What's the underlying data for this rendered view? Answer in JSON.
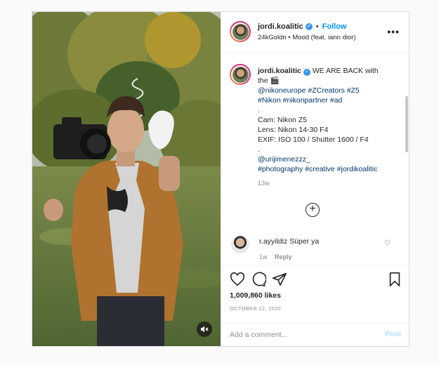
{
  "post": {
    "username": "jordi.koalitic",
    "follow_label": "Follow",
    "audio": "24kGoldn • Mood (feat. iann dior)",
    "more_label": "•••"
  },
  "caption": {
    "username": "jordi.koalitic",
    "line1": "WE ARE BACK with",
    "line2": "the 🎬",
    "tags1": "@nikoneurope #ZCreators #Z5",
    "tags2": "#Nikon #nikonpartner #ad",
    "dot1": ".",
    "cam": "Cam: Nikon Z5",
    "lens": "Lens: Nikon 14-30 F4",
    "exif": "EXIF: ISO 100 / Shutter 1600 / F4",
    "dot2": ".",
    "mention": "@urijimenezzz_",
    "tags3": "#photography #creative #jordikoalitic",
    "time": "13w"
  },
  "comment": {
    "username": "r.ayyildiz",
    "text": "Süper ya",
    "time": "1w",
    "reply_label": "Reply"
  },
  "stats": {
    "likes": "1,009,860 likes",
    "date": "OCTOBER 22, 2020"
  },
  "composer": {
    "placeholder": "Add a comment...",
    "post_label": "Post"
  },
  "colors": {
    "accent": "#0095f6",
    "verified": "#3897f0"
  }
}
